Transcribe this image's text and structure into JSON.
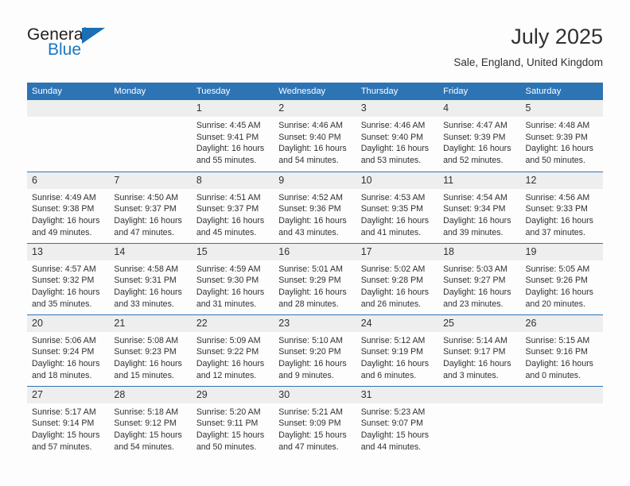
{
  "brand": {
    "name_top": "General",
    "name_bottom": "Blue",
    "triangle_color": "#1a6fb5",
    "blue_color": "#1a77c5"
  },
  "header": {
    "month_year": "July 2025",
    "location": "Sale, England, United Kingdom"
  },
  "theme": {
    "header_blue": "#2d74b5",
    "daynum_gray": "#eeeeee",
    "text": "#303030"
  },
  "calendar": {
    "weekday_headers": [
      "Sunday",
      "Monday",
      "Tuesday",
      "Wednesday",
      "Thursday",
      "Friday",
      "Saturday"
    ],
    "weeks": [
      [
        {
          "day": "",
          "lines": []
        },
        {
          "day": "",
          "lines": []
        },
        {
          "day": "1",
          "lines": [
            "Sunrise: 4:45 AM",
            "Sunset: 9:41 PM",
            "Daylight: 16 hours",
            "and 55 minutes."
          ]
        },
        {
          "day": "2",
          "lines": [
            "Sunrise: 4:46 AM",
            "Sunset: 9:40 PM",
            "Daylight: 16 hours",
            "and 54 minutes."
          ]
        },
        {
          "day": "3",
          "lines": [
            "Sunrise: 4:46 AM",
            "Sunset: 9:40 PM",
            "Daylight: 16 hours",
            "and 53 minutes."
          ]
        },
        {
          "day": "4",
          "lines": [
            "Sunrise: 4:47 AM",
            "Sunset: 9:39 PM",
            "Daylight: 16 hours",
            "and 52 minutes."
          ]
        },
        {
          "day": "5",
          "lines": [
            "Sunrise: 4:48 AM",
            "Sunset: 9:39 PM",
            "Daylight: 16 hours",
            "and 50 minutes."
          ]
        }
      ],
      [
        {
          "day": "6",
          "lines": [
            "Sunrise: 4:49 AM",
            "Sunset: 9:38 PM",
            "Daylight: 16 hours",
            "and 49 minutes."
          ]
        },
        {
          "day": "7",
          "lines": [
            "Sunrise: 4:50 AM",
            "Sunset: 9:37 PM",
            "Daylight: 16 hours",
            "and 47 minutes."
          ]
        },
        {
          "day": "8",
          "lines": [
            "Sunrise: 4:51 AM",
            "Sunset: 9:37 PM",
            "Daylight: 16 hours",
            "and 45 minutes."
          ]
        },
        {
          "day": "9",
          "lines": [
            "Sunrise: 4:52 AM",
            "Sunset: 9:36 PM",
            "Daylight: 16 hours",
            "and 43 minutes."
          ]
        },
        {
          "day": "10",
          "lines": [
            "Sunrise: 4:53 AM",
            "Sunset: 9:35 PM",
            "Daylight: 16 hours",
            "and 41 minutes."
          ]
        },
        {
          "day": "11",
          "lines": [
            "Sunrise: 4:54 AM",
            "Sunset: 9:34 PM",
            "Daylight: 16 hours",
            "and 39 minutes."
          ]
        },
        {
          "day": "12",
          "lines": [
            "Sunrise: 4:56 AM",
            "Sunset: 9:33 PM",
            "Daylight: 16 hours",
            "and 37 minutes."
          ]
        }
      ],
      [
        {
          "day": "13",
          "lines": [
            "Sunrise: 4:57 AM",
            "Sunset: 9:32 PM",
            "Daylight: 16 hours",
            "and 35 minutes."
          ]
        },
        {
          "day": "14",
          "lines": [
            "Sunrise: 4:58 AM",
            "Sunset: 9:31 PM",
            "Daylight: 16 hours",
            "and 33 minutes."
          ]
        },
        {
          "day": "15",
          "lines": [
            "Sunrise: 4:59 AM",
            "Sunset: 9:30 PM",
            "Daylight: 16 hours",
            "and 31 minutes."
          ]
        },
        {
          "day": "16",
          "lines": [
            "Sunrise: 5:01 AM",
            "Sunset: 9:29 PM",
            "Daylight: 16 hours",
            "and 28 minutes."
          ]
        },
        {
          "day": "17",
          "lines": [
            "Sunrise: 5:02 AM",
            "Sunset: 9:28 PM",
            "Daylight: 16 hours",
            "and 26 minutes."
          ]
        },
        {
          "day": "18",
          "lines": [
            "Sunrise: 5:03 AM",
            "Sunset: 9:27 PM",
            "Daylight: 16 hours",
            "and 23 minutes."
          ]
        },
        {
          "day": "19",
          "lines": [
            "Sunrise: 5:05 AM",
            "Sunset: 9:26 PM",
            "Daylight: 16 hours",
            "and 20 minutes."
          ]
        }
      ],
      [
        {
          "day": "20",
          "lines": [
            "Sunrise: 5:06 AM",
            "Sunset: 9:24 PM",
            "Daylight: 16 hours",
            "and 18 minutes."
          ]
        },
        {
          "day": "21",
          "lines": [
            "Sunrise: 5:08 AM",
            "Sunset: 9:23 PM",
            "Daylight: 16 hours",
            "and 15 minutes."
          ]
        },
        {
          "day": "22",
          "lines": [
            "Sunrise: 5:09 AM",
            "Sunset: 9:22 PM",
            "Daylight: 16 hours",
            "and 12 minutes."
          ]
        },
        {
          "day": "23",
          "lines": [
            "Sunrise: 5:10 AM",
            "Sunset: 9:20 PM",
            "Daylight: 16 hours",
            "and 9 minutes."
          ]
        },
        {
          "day": "24",
          "lines": [
            "Sunrise: 5:12 AM",
            "Sunset: 9:19 PM",
            "Daylight: 16 hours",
            "and 6 minutes."
          ]
        },
        {
          "day": "25",
          "lines": [
            "Sunrise: 5:14 AM",
            "Sunset: 9:17 PM",
            "Daylight: 16 hours",
            "and 3 minutes."
          ]
        },
        {
          "day": "26",
          "lines": [
            "Sunrise: 5:15 AM",
            "Sunset: 9:16 PM",
            "Daylight: 16 hours",
            "and 0 minutes."
          ]
        }
      ],
      [
        {
          "day": "27",
          "lines": [
            "Sunrise: 5:17 AM",
            "Sunset: 9:14 PM",
            "Daylight: 15 hours",
            "and 57 minutes."
          ]
        },
        {
          "day": "28",
          "lines": [
            "Sunrise: 5:18 AM",
            "Sunset: 9:12 PM",
            "Daylight: 15 hours",
            "and 54 minutes."
          ]
        },
        {
          "day": "29",
          "lines": [
            "Sunrise: 5:20 AM",
            "Sunset: 9:11 PM",
            "Daylight: 15 hours",
            "and 50 minutes."
          ]
        },
        {
          "day": "30",
          "lines": [
            "Sunrise: 5:21 AM",
            "Sunset: 9:09 PM",
            "Daylight: 15 hours",
            "and 47 minutes."
          ]
        },
        {
          "day": "31",
          "lines": [
            "Sunrise: 5:23 AM",
            "Sunset: 9:07 PM",
            "Daylight: 15 hours",
            "and 44 minutes."
          ]
        },
        {
          "day": "",
          "lines": []
        },
        {
          "day": "",
          "lines": []
        }
      ]
    ]
  }
}
